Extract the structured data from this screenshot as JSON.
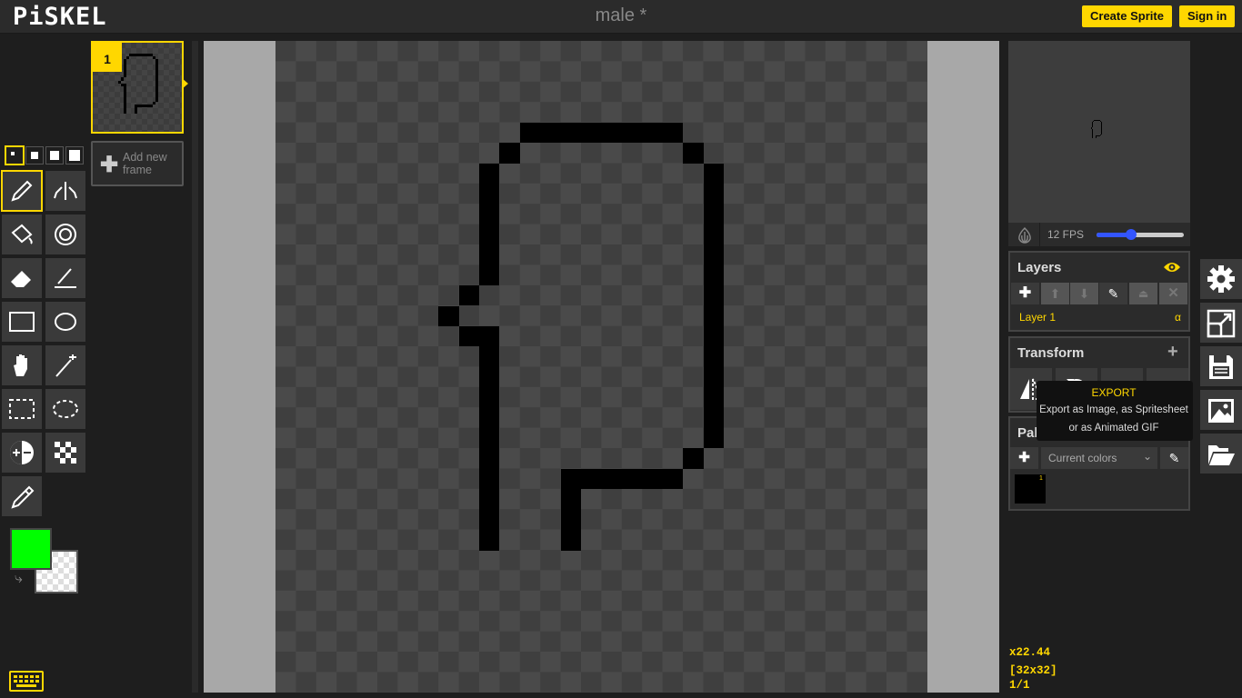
{
  "header": {
    "logo": "PiSKEL",
    "doc_title": "male *",
    "create_sprite": "Create Sprite",
    "sign_in": "Sign in"
  },
  "frames": {
    "items": [
      {
        "number": "1"
      }
    ],
    "add_label": "Add new frame"
  },
  "toolbox": {
    "pen_sizes": [
      "1",
      "2",
      "3",
      "4"
    ],
    "selected_pen_size": "1",
    "tools": [
      "pen-icon",
      "vertical-mirror-pen-icon",
      "paint-bucket-icon",
      "paint-all-same-color-icon",
      "eraser-icon",
      "stroke-icon",
      "rectangle-icon",
      "circle-icon",
      "move-hand-icon",
      "shape-select-magic-wand-icon",
      "rectangle-select-icon",
      "lasso-select-icon",
      "lighten-darken-icon",
      "dithering-icon",
      "color-picker-icon"
    ],
    "active_tool": "pen-icon"
  },
  "colors": {
    "primary": "#00ff00",
    "secondary": "transparent"
  },
  "preview": {
    "fps_label": "12 FPS",
    "fps": 12,
    "fps_fraction": 0.4
  },
  "layers": {
    "title": "Layers",
    "items": [
      {
        "name": "Layer 1",
        "alpha": "α"
      }
    ]
  },
  "transform": {
    "title": "Transform"
  },
  "palettes": {
    "title": "Palettes",
    "selected": "Current colors",
    "options": [
      "Current colors"
    ],
    "swatches": [
      {
        "color": "#000000",
        "index": "1"
      }
    ]
  },
  "tooltip": {
    "title": "EXPORT",
    "line1": "Export as Image, as Spritesheet",
    "line2": "or as Animated GIF"
  },
  "status": {
    "zoom": "x22.44",
    "size": "[32x32]",
    "frame": "1/1"
  },
  "accent": "#ffd700"
}
